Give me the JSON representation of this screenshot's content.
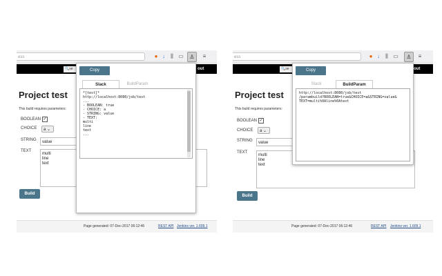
{
  "browser": {
    "url_fragment": "ess",
    "icons": [
      "firefox-icon",
      "download-icon",
      "library-icon",
      "sidebar-icon",
      "extension-icon",
      "menu-icon"
    ],
    "menu_glyph": "≡"
  },
  "header": {
    "search_stub": "se",
    "logout_label": "out"
  },
  "page": {
    "title": "Project test",
    "description": "This build requires parameters:",
    "params": [
      {
        "name": "BOOLEAN",
        "type": "checkbox",
        "checked": true
      },
      {
        "name": "CHOICE",
        "type": "select",
        "value": "a"
      },
      {
        "name": "STRING",
        "type": "string",
        "value": "value"
      },
      {
        "name": "TEXT",
        "type": "text",
        "value": "multi\nline\ntext"
      }
    ],
    "build_label": "Build"
  },
  "footer": {
    "generated": "Page generated: 07-Dec-2017 06:12:46",
    "rest_api": "REST API",
    "jenkins_ver": "Jenkins ver. 1.609.1"
  },
  "popup_left": {
    "copy_label": "Copy",
    "tabs": [
      {
        "label": "Slack",
        "active": true
      },
      {
        "label": "BuildParam",
        "active": false
      }
    ],
    "content": "*[test]*\nhttp://localhost:8080/job/test\n...\n- BOOLEAN: true\n- CHOICE: a\n- STRING: value\n- TEXT:\nmulti\nline\ntext\n..."
  },
  "popup_right": {
    "copy_label": "Copy",
    "tabs": [
      {
        "label": "Slack",
        "active": false
      },
      {
        "label": "BuildParam",
        "active": true
      }
    ],
    "content": "http://localhost:8080/job/test\n/parambuild?BOOLEAN=true&CHOICE=a&STRING=value&\nTEXT=multi%0Aline%0Atext"
  },
  "colors": {
    "accent": "#4b758b",
    "header_bg": "#000000"
  }
}
